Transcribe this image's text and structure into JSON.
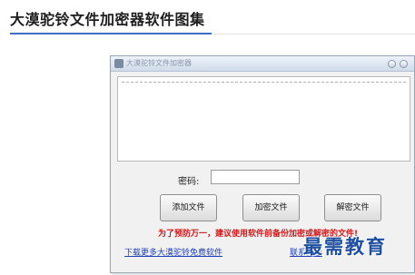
{
  "page": {
    "title": "大漠驼铃文件加密器软件图集"
  },
  "window": {
    "title": "大漠驼铃文件加密器",
    "password_label": "密码:",
    "password_value": "",
    "buttons": {
      "add_file": "添加文件",
      "encrypt_file": "加密文件",
      "decrypt_file": "解密文件"
    },
    "warning": "为了预防万一，建议使用软件前备份加密或解密的文件!",
    "links": {
      "download_more": "下载更多大漠驼铃免费软件",
      "contact": "联系作者"
    }
  },
  "watermark": "最需教育",
  "colors": {
    "accent": "#3a6fc4",
    "warning": "#d11a1a",
    "link": "#1f3fb8"
  }
}
